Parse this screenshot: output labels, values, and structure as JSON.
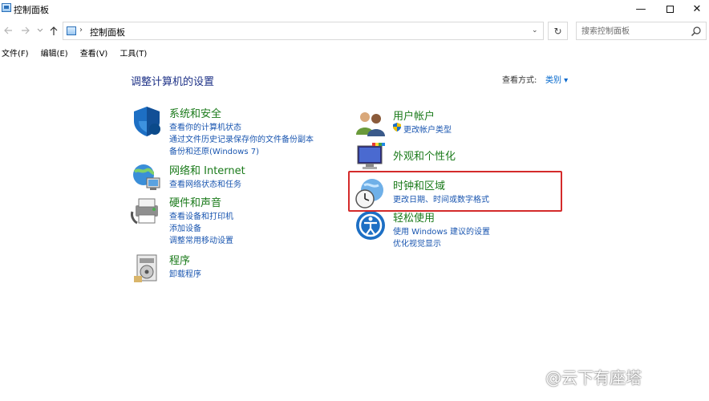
{
  "window": {
    "title": "控制面板",
    "minimize": "—",
    "close": "✕"
  },
  "address": {
    "separator": "›",
    "crumb": "控制面板",
    "dropdown": "⌄",
    "refresh": "↻"
  },
  "search": {
    "placeholder": "搜索控制面板"
  },
  "menu": [
    {
      "label": "文件(F)"
    },
    {
      "label": "编辑(E)"
    },
    {
      "label": "查看(V)"
    },
    {
      "label": "工具(T)"
    }
  ],
  "main": {
    "heading": "调整计算机的设置",
    "view_by_label": "查看方式:",
    "view_by_value": "类别 ▾"
  },
  "categories_left": [
    {
      "title": "系统和安全",
      "links": [
        "查看你的计算机状态",
        "通过文件历史记录保存你的文件备份副本",
        "备份和还原(Windows 7)"
      ]
    },
    {
      "title": "网络和 Internet",
      "links": [
        "查看网络状态和任务"
      ]
    },
    {
      "title": "硬件和声音",
      "links": [
        "查看设备和打印机",
        "添加设备",
        "调整常用移动设置"
      ]
    },
    {
      "title": "程序",
      "links": [
        "卸载程序"
      ]
    }
  ],
  "categories_right": [
    {
      "title": "用户帐户",
      "links": [
        "更改帐户类型"
      ]
    },
    {
      "title": "外观和个性化",
      "links": []
    },
    {
      "title": "时钟和区域",
      "links": [
        "更改日期、时间或数字格式"
      ]
    },
    {
      "title": "轻松使用",
      "links": [
        "使用 Windows 建议的设置",
        "优化视觉显示"
      ]
    }
  ],
  "watermark": "@云下有座塔",
  "colors": {
    "category_title": "#1a7a1a",
    "link": "#1a56b0",
    "heading": "#1e3287",
    "highlight": "#d42b2b"
  }
}
